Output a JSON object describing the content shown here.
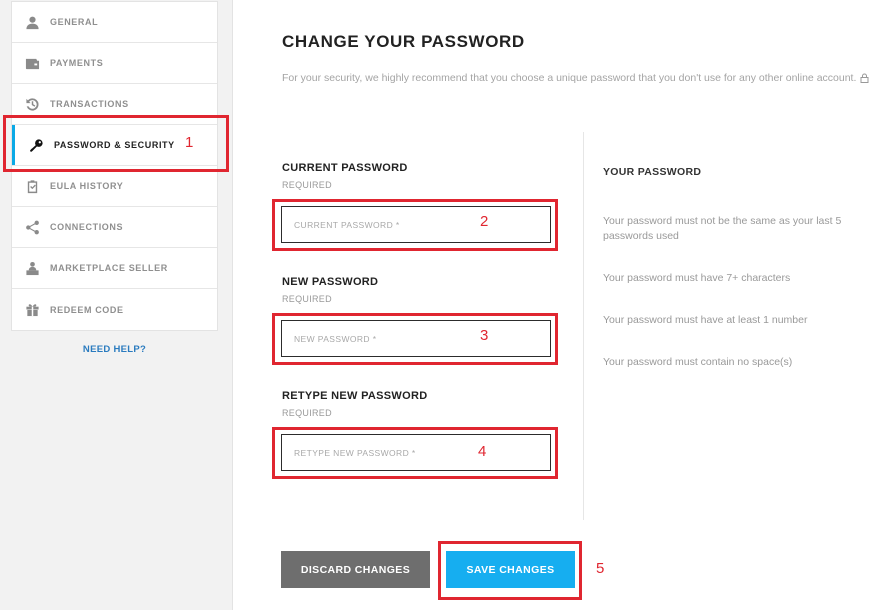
{
  "sidebar": {
    "items": [
      {
        "label": "GENERAL",
        "icon": "user-icon"
      },
      {
        "label": "PAYMENTS",
        "icon": "wallet-icon"
      },
      {
        "label": "TRANSACTIONS",
        "icon": "history-icon"
      },
      {
        "label": "PASSWORD & SECURITY",
        "icon": "key-icon",
        "active": true
      },
      {
        "label": "EULA HISTORY",
        "icon": "clipboard-icon"
      },
      {
        "label": "CONNECTIONS",
        "icon": "share-icon"
      },
      {
        "label": "MARKETPLACE SELLER",
        "icon": "seller-icon"
      },
      {
        "label": "REDEEM CODE",
        "icon": "gift-icon"
      }
    ],
    "need_help": "NEED HELP?"
  },
  "main": {
    "title": "CHANGE YOUR PASSWORD",
    "intro": "For your security, we highly recommend that you choose a unique password that you don't use for any other online account.",
    "fields": {
      "current": {
        "label": "CURRENT PASSWORD",
        "required": "REQUIRED",
        "placeholder": "CURRENT PASSWORD *",
        "value": ""
      },
      "new": {
        "label": "NEW PASSWORD",
        "required": "REQUIRED",
        "placeholder": "NEW PASSWORD *",
        "value": ""
      },
      "retype": {
        "label": "RETYPE NEW PASSWORD",
        "required": "REQUIRED",
        "placeholder": "RETYPE NEW PASSWORD *",
        "value": ""
      }
    },
    "rules": {
      "title": "YOUR PASSWORD",
      "items": [
        "Your password must not be the same as your last 5 passwords used",
        "Your password must have 7+ characters",
        "Your password must have at least 1 number",
        "Your password must contain no space(s)"
      ]
    },
    "buttons": {
      "discard": "DISCARD CHANGES",
      "save": "SAVE CHANGES"
    }
  },
  "annotations": [
    "1",
    "2",
    "3",
    "4",
    "5"
  ],
  "colors": {
    "accent": "#16aef0",
    "annotation": "#e02630",
    "discard": "#6e6e6e",
    "link": "#2a7bbf"
  }
}
